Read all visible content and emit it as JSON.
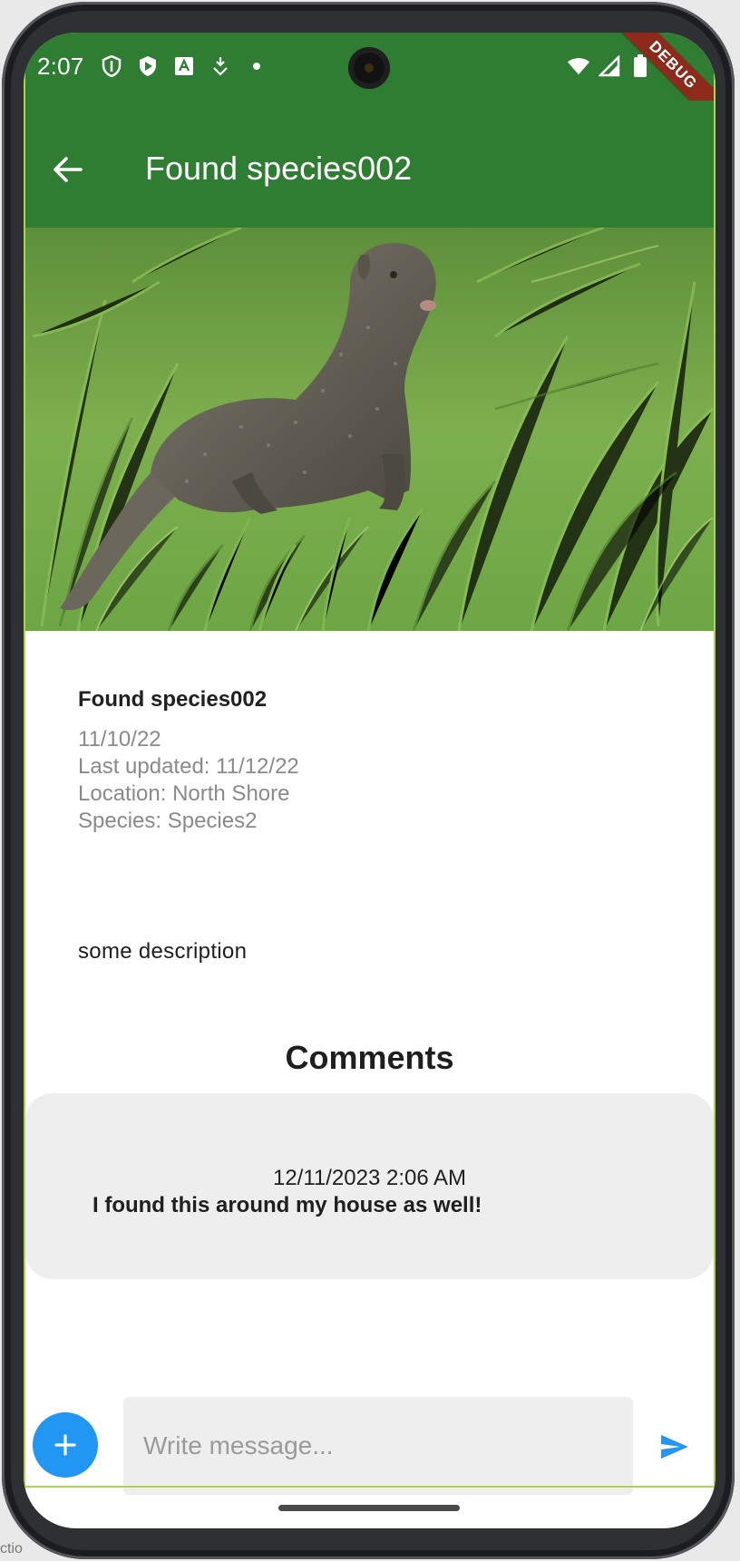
{
  "status_bar": {
    "time": "2:07",
    "left_icons": [
      "shield-outline-icon",
      "shield-play-icon",
      "font-a-icon",
      "download-signal-icon",
      "dot-icon"
    ],
    "right_icons": [
      "wifi-icon",
      "cell-signal-icon",
      "battery-icon"
    ],
    "debug_label": "DEBUG"
  },
  "app_bar": {
    "title": "Found species002",
    "back_icon": "arrow-back-icon",
    "background_color": "#2e7d32"
  },
  "hero_image": {
    "subject": "mongoose in grass"
  },
  "sighting": {
    "title": "Found species002",
    "date": "11/10/22",
    "last_updated": "Last updated: 11/12/22",
    "location": "Location: North Shore",
    "species": "Species: Species2",
    "description": "some description"
  },
  "comments": {
    "heading": "Comments",
    "items": [
      {
        "timestamp": "12/11/2023 2:06 AM",
        "text": "I found this around my house as well!"
      }
    ]
  },
  "composer": {
    "add_icon": "plus-icon",
    "placeholder": "Write message...",
    "value": "",
    "send_icon": "send-icon",
    "accent_color": "#2196f3"
  },
  "outside_caption": "ctio"
}
